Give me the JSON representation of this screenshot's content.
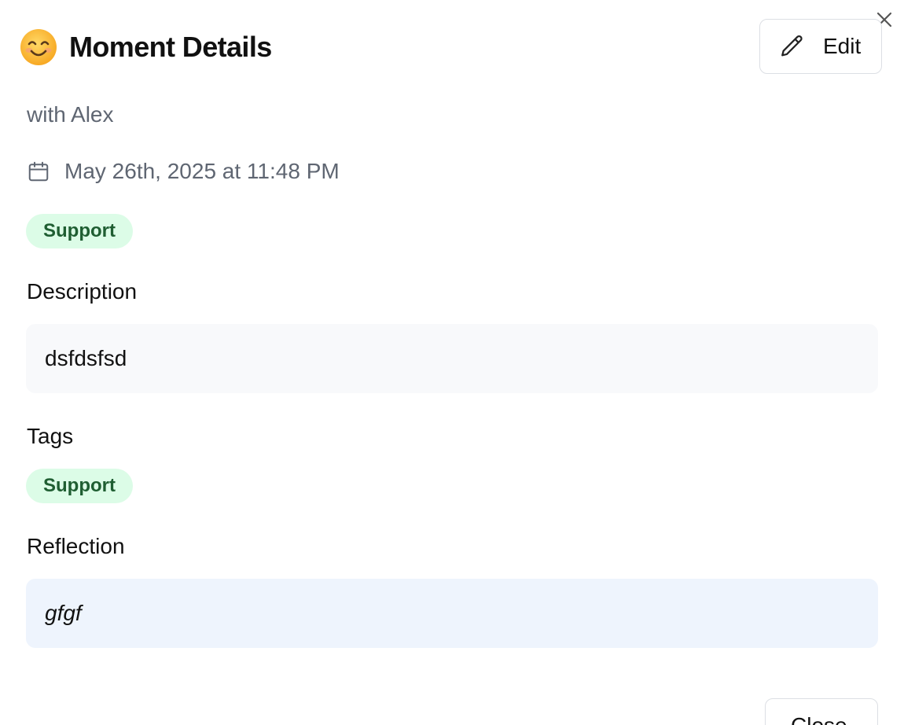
{
  "modal": {
    "emoji_icon": "smiling-face-emoji",
    "title": "Moment Details",
    "edit_label": "Edit",
    "with_text": "with Alex",
    "date_text": "May 26th, 2025 at 11:48 PM",
    "category_badge": "Support",
    "description_label": "Description",
    "description_text": "dsfdsfsd",
    "tags_label": "Tags",
    "tags": [
      "Support"
    ],
    "reflection_label": "Reflection",
    "reflection_text": "gfgf",
    "footer_button_label": "Close"
  },
  "colors": {
    "badge_bg": "#dcfce7",
    "badge_text": "#1f5e32",
    "description_bg": "#f8f9fb",
    "reflection_bg": "#eef4fd",
    "muted_text": "#5f6672"
  }
}
